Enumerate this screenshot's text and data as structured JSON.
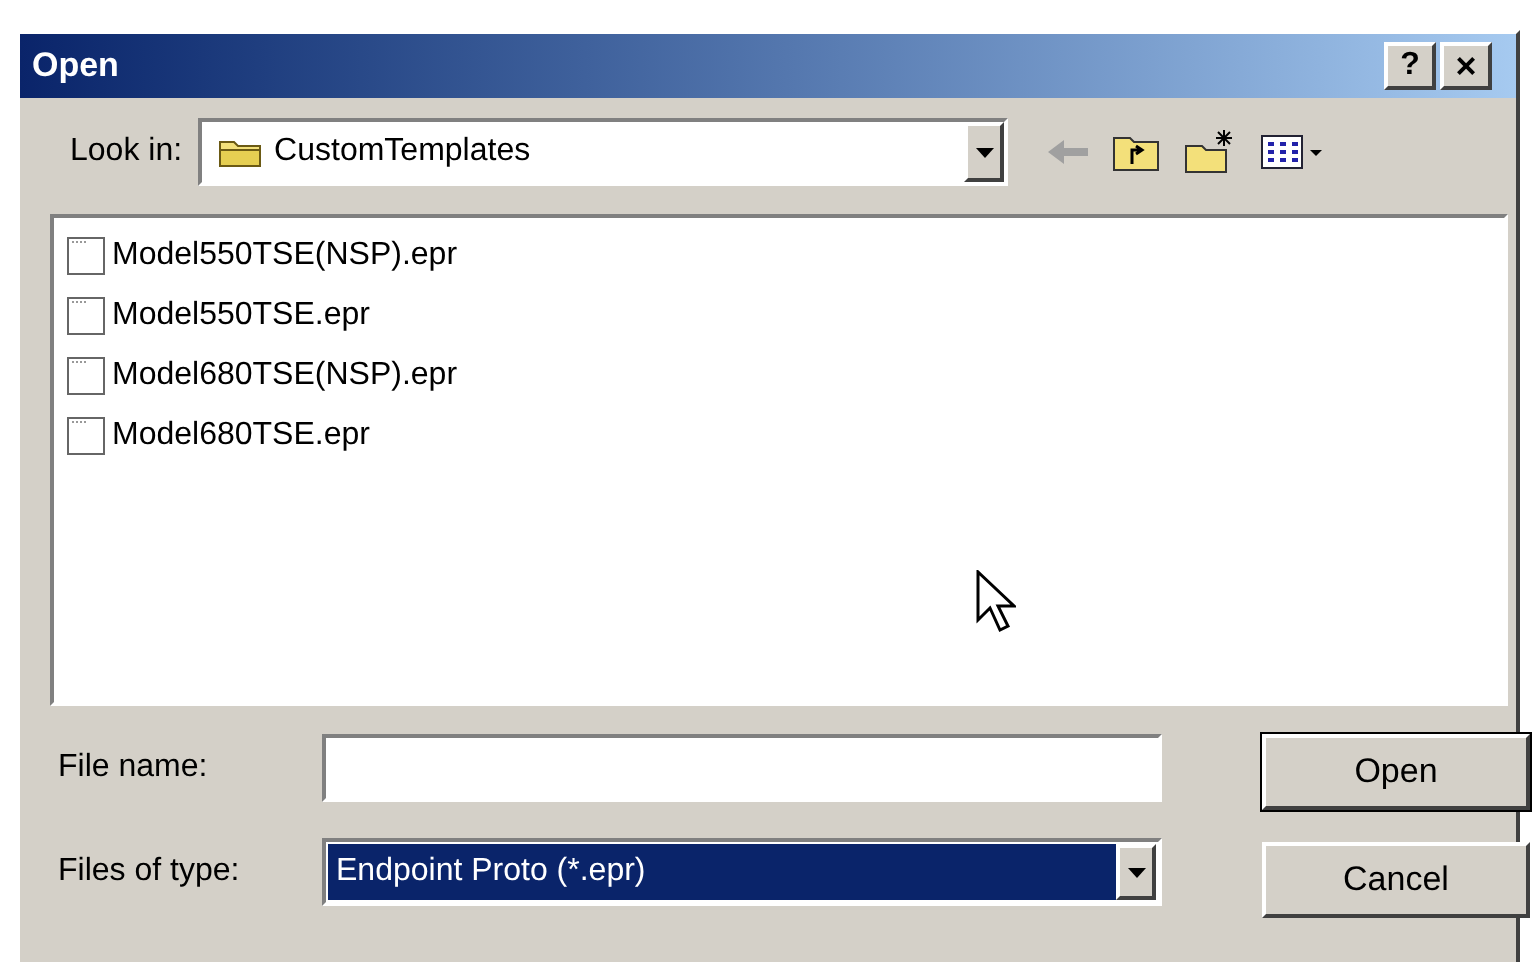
{
  "window": {
    "title": "Open",
    "help_button": "?",
    "close_button": "×"
  },
  "look_in": {
    "label": "Look in:",
    "value": "CustomTemplates"
  },
  "files": [
    {
      "name": "Model550TSE(NSP).epr",
      "selected": false
    },
    {
      "name": "Model550TSE.epr",
      "selected": false
    },
    {
      "name": "Model680TSE(NSP).epr",
      "selected": false
    },
    {
      "name": "Model680TSE.epr",
      "selected": false
    }
  ],
  "file_name": {
    "label": "File name:"
  },
  "files_of_type": {
    "label": "Files of type:",
    "value": "Endpoint Proto (*.epr)",
    "selected": true
  },
  "buttons": [
    {
      "label": "Open",
      "default": true
    },
    {
      "label": "Cancel",
      "default": false
    }
  ]
}
